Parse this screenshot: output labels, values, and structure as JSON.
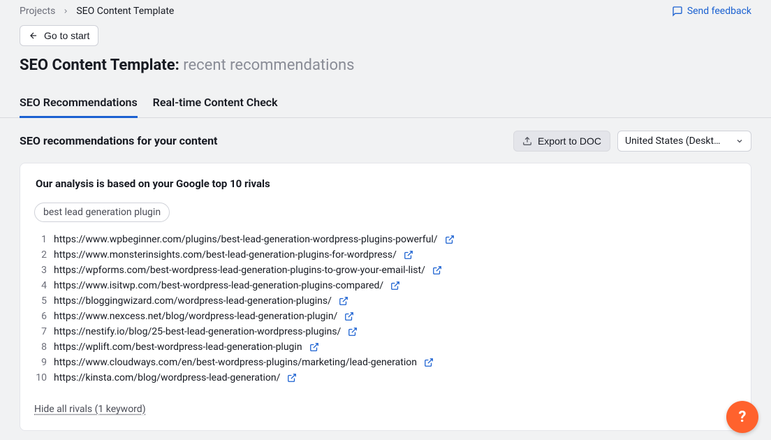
{
  "breadcrumb": {
    "link": "Projects",
    "current": "SEO Content Template"
  },
  "feedback": "Send feedback",
  "go_start": "Go to start",
  "title": "SEO Content Template:",
  "title_sub": "recent recommendations",
  "tabs": {
    "t1": "SEO Recommendations",
    "t2": "Real-time Content Check"
  },
  "section_title": "SEO recommendations for your content",
  "export_label": "Export to DOC",
  "country_selected": "United States (Deskt…",
  "card_title": "Our analysis is based on your Google top 10 rivals",
  "keyword": "best lead generation plugin",
  "rivals": [
    "https://www.wpbeginner.com/plugins/best-lead-generation-wordpress-plugins-powerful/",
    "https://www.monsterinsights.com/best-lead-generation-plugins-for-wordpress/",
    "https://wpforms.com/best-wordpress-lead-generation-plugins-to-grow-your-email-list/",
    "https://www.isitwp.com/best-wordpress-lead-generation-plugins-compared/",
    "https://bloggingwizard.com/wordpress-lead-generation-plugins/",
    "https://www.nexcess.net/blog/wordpress-lead-generation-plugin/",
    "https://nestify.io/blog/25-best-lead-generation-wordpress-plugins/",
    "https://wplift.com/best-wordpress-lead-generation-plugin",
    "https://www.cloudways.com/en/best-wordpress-plugins/marketing/lead-generation",
    "https://kinsta.com/blog/wordpress-lead-generation/"
  ],
  "hide_link": "Hide all rivals (1 keyword)",
  "help": "?"
}
